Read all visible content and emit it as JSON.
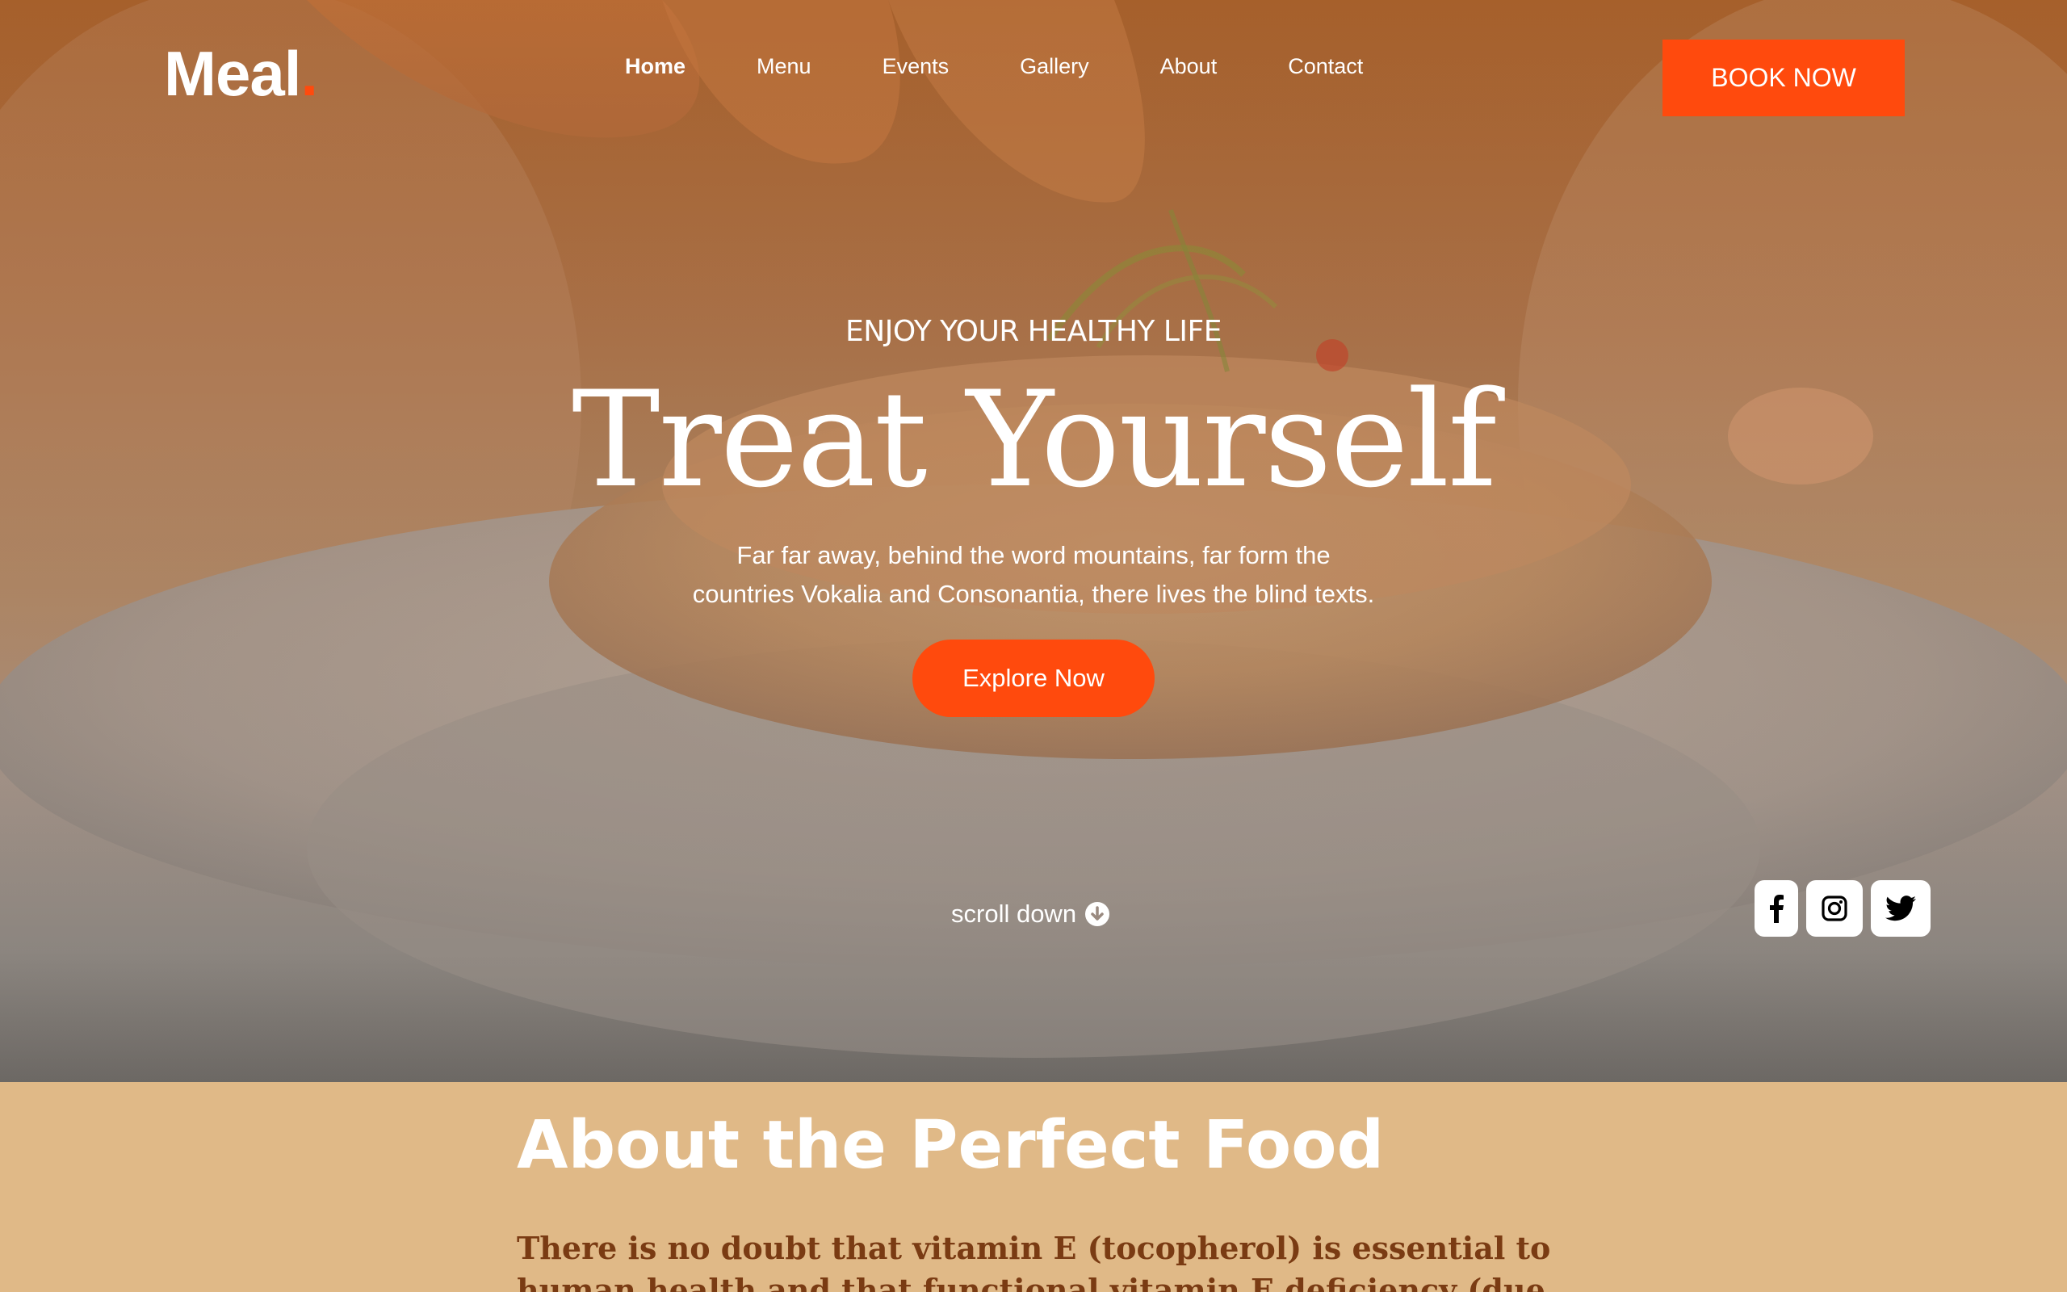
{
  "brand": {
    "logo_text": "Meal",
    "logo_dot": ".",
    "accent_color": "#ff4a0d"
  },
  "nav": {
    "items": [
      {
        "label": "Home",
        "active": true
      },
      {
        "label": "Menu",
        "active": false
      },
      {
        "label": "Events",
        "active": false
      },
      {
        "label": "Gallery",
        "active": false
      },
      {
        "label": "About",
        "active": false
      },
      {
        "label": "Contact",
        "active": false
      }
    ],
    "book_label": "BOOK NOW"
  },
  "hero": {
    "eyebrow": "ENJOY YOUR HEALTHY LIFE",
    "title": "Treat Yourself",
    "description_line1": "Far far away, behind the word mountains, far form the",
    "description_line2": "countries Vokalia and Consonantia, there lives the blind texts.",
    "cta_label": "Explore Now",
    "scroll_label": "scroll down",
    "scroll_icon": "arrow-down-circle-icon"
  },
  "socials": [
    {
      "name": "facebook-icon"
    },
    {
      "name": "instagram-icon"
    },
    {
      "name": "twitter-icon"
    }
  ],
  "about": {
    "title": "About the Perfect Food",
    "text": "There is no doubt that vitamin E (tocopherol) is essential to human health and that functional vitamin E deficiency (due to either"
  }
}
